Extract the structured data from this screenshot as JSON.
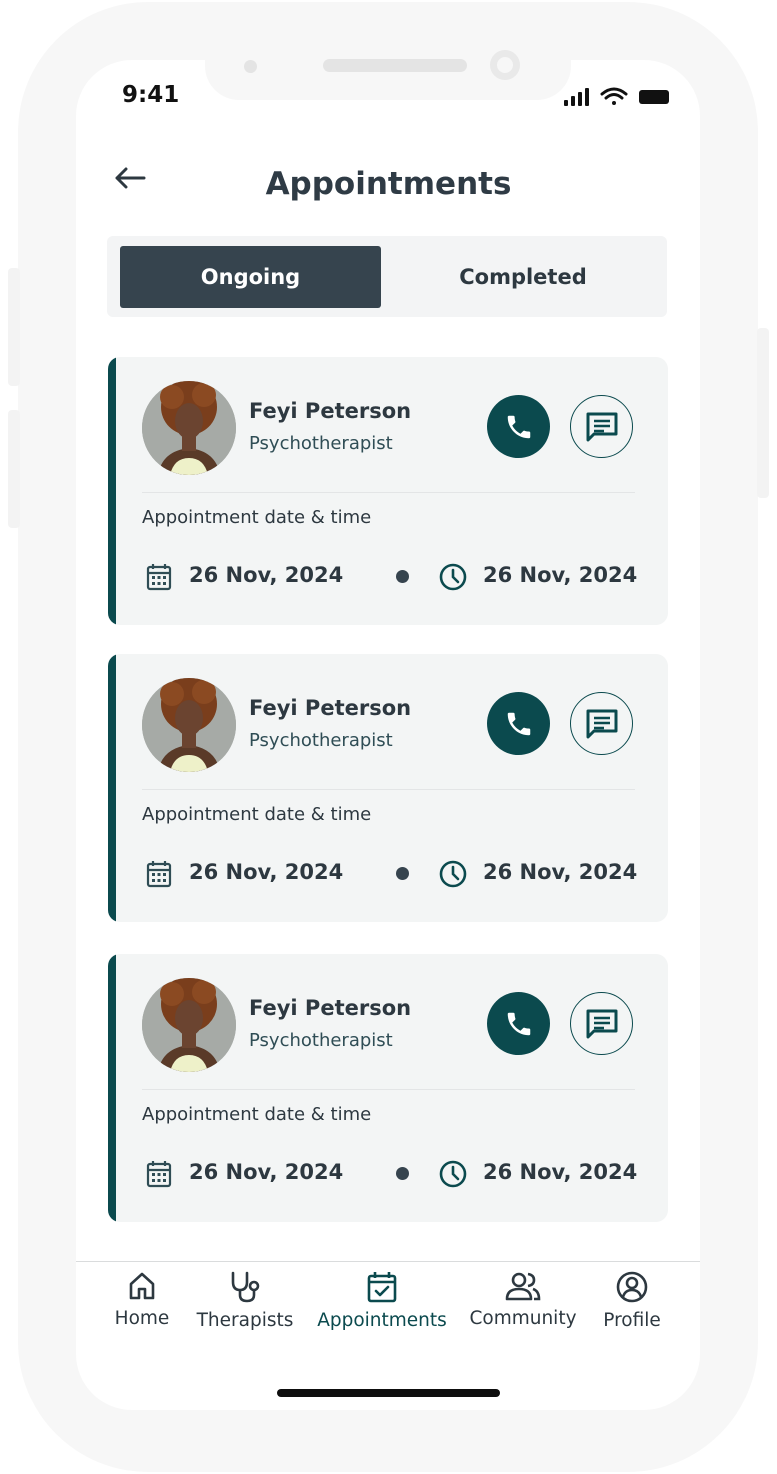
{
  "status_bar": {
    "time": "9:41"
  },
  "header": {
    "title": "Appointments"
  },
  "tabs": [
    {
      "label": "Ongoing",
      "active": true
    },
    {
      "label": "Completed",
      "active": false
    }
  ],
  "appointments": [
    {
      "name": "Feyi Peterson",
      "role": "Psychotherapist",
      "date_label": "Appointment date & time",
      "date": "26 Nov, 2024",
      "time": "26 Nov, 2024"
    },
    {
      "name": "Feyi Peterson",
      "role": "Psychotherapist",
      "date_label": "Appointment date & time",
      "date": "26 Nov, 2024",
      "time": "26 Nov, 2024"
    },
    {
      "name": "Feyi Peterson",
      "role": "Psychotherapist",
      "date_label": "Appointment date & time",
      "date": "26 Nov, 2024",
      "time": "26 Nov, 2024"
    }
  ],
  "bottom_nav": [
    {
      "label": "Home",
      "icon": "home-icon"
    },
    {
      "label": "Therapists",
      "icon": "stethoscope-icon"
    },
    {
      "label": "Appointments",
      "icon": "calendar-check-icon",
      "active": true
    },
    {
      "label": "Community",
      "icon": "users-icon"
    },
    {
      "label": "Profile",
      "icon": "profile-icon"
    }
  ],
  "colors": {
    "primary": "#0b4a4e",
    "dark": "#36444e",
    "card_bg": "#f3f5f5",
    "text": "#2d3840"
  }
}
